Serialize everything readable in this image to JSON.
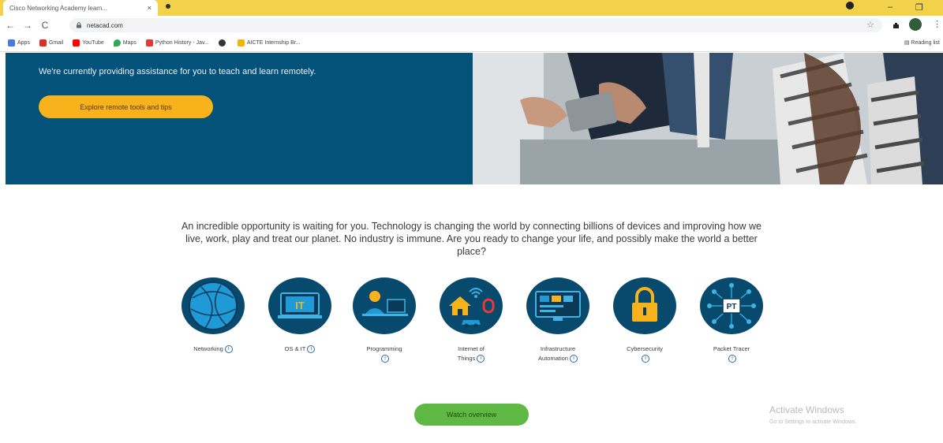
{
  "browser": {
    "tab_title": "Cisco Networking Academy learn...",
    "tab_close": "×",
    "url": "netacad.com",
    "nav": {
      "back": "←",
      "forward": "→",
      "reload": "C"
    },
    "star": "☆",
    "window_controls": [
      "–",
      "❐"
    ]
  },
  "bookmarks": {
    "items": [
      {
        "label": "Apps",
        "color": "#4a7bd8"
      },
      {
        "label": "Gmail",
        "color": "#d93025"
      },
      {
        "label": "YouTube",
        "color": "#ff0000"
      },
      {
        "label": "Maps",
        "color": "#34a853"
      },
      {
        "label": "Python History - Jav...",
        "color": "#e53935"
      },
      {
        "label": "",
        "color": "#333333"
      },
      {
        "label": "AICTE Internship Br...",
        "color": "#f4b400"
      }
    ],
    "reading_list": "Reading list"
  },
  "hero": {
    "text": "We're currently providing assistance for you to teach and learn remotely.",
    "button": "Explore remote tools and tips",
    "bg_color": "#04517a",
    "button_color": "#f8b21c"
  },
  "intro": {
    "line1": "An incredible opportunity is waiting for you. Technology is changing the world by connecting billions of devices and improving how we",
    "line2": "live, work, play and treat our planet. No industry is immune. Are you ready to change your life, and possibly make the world a better",
    "line3": "place?"
  },
  "courses": [
    {
      "icon": "networking-icon",
      "label_lines": [
        "Networking"
      ]
    },
    {
      "icon": "os-it-icon",
      "label_lines": [
        "OS & IT"
      ]
    },
    {
      "icon": "programming-icon",
      "label_lines": [
        "Programming",
        ""
      ]
    },
    {
      "icon": "iot-icon",
      "label_lines": [
        "Internet of",
        "Things"
      ]
    },
    {
      "icon": "infrastructure-automation-icon",
      "label_lines": [
        "Infrastructure",
        "Automation"
      ]
    },
    {
      "icon": "cybersecurity-icon",
      "label_lines": [
        "Cybersecurity",
        ""
      ]
    },
    {
      "icon": "packet-tracer-icon",
      "label_lines": [
        "Packet Tracer",
        ""
      ]
    }
  ],
  "icon_text": {
    "it": "IT",
    "pt": "PT"
  },
  "info_glyph": "i",
  "watch_button": "Watch overview",
  "watermark": {
    "title": "Activate Windows",
    "subtitle": "Go to Settings to activate Windows."
  }
}
